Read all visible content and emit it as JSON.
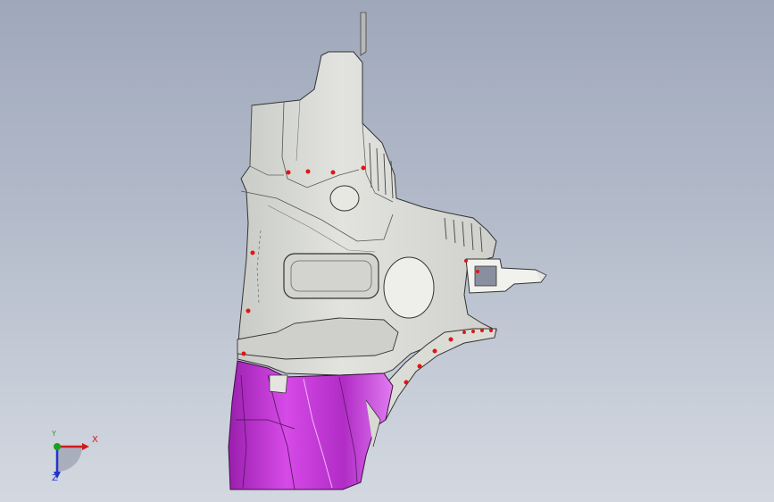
{
  "viewport": {
    "background_top": "#9fa8bb",
    "background_bottom": "#d3d8e0",
    "part_color_gray": "#d9dad5",
    "part_color_magenta": "#c42fd8",
    "hole_marker_color": "#e01515"
  },
  "triad": {
    "x_label": "X",
    "y_label": "Y",
    "z_label": "Z",
    "x_color": "#d11a1a",
    "y_color": "#1aa11a",
    "z_color": "#2233cc"
  }
}
